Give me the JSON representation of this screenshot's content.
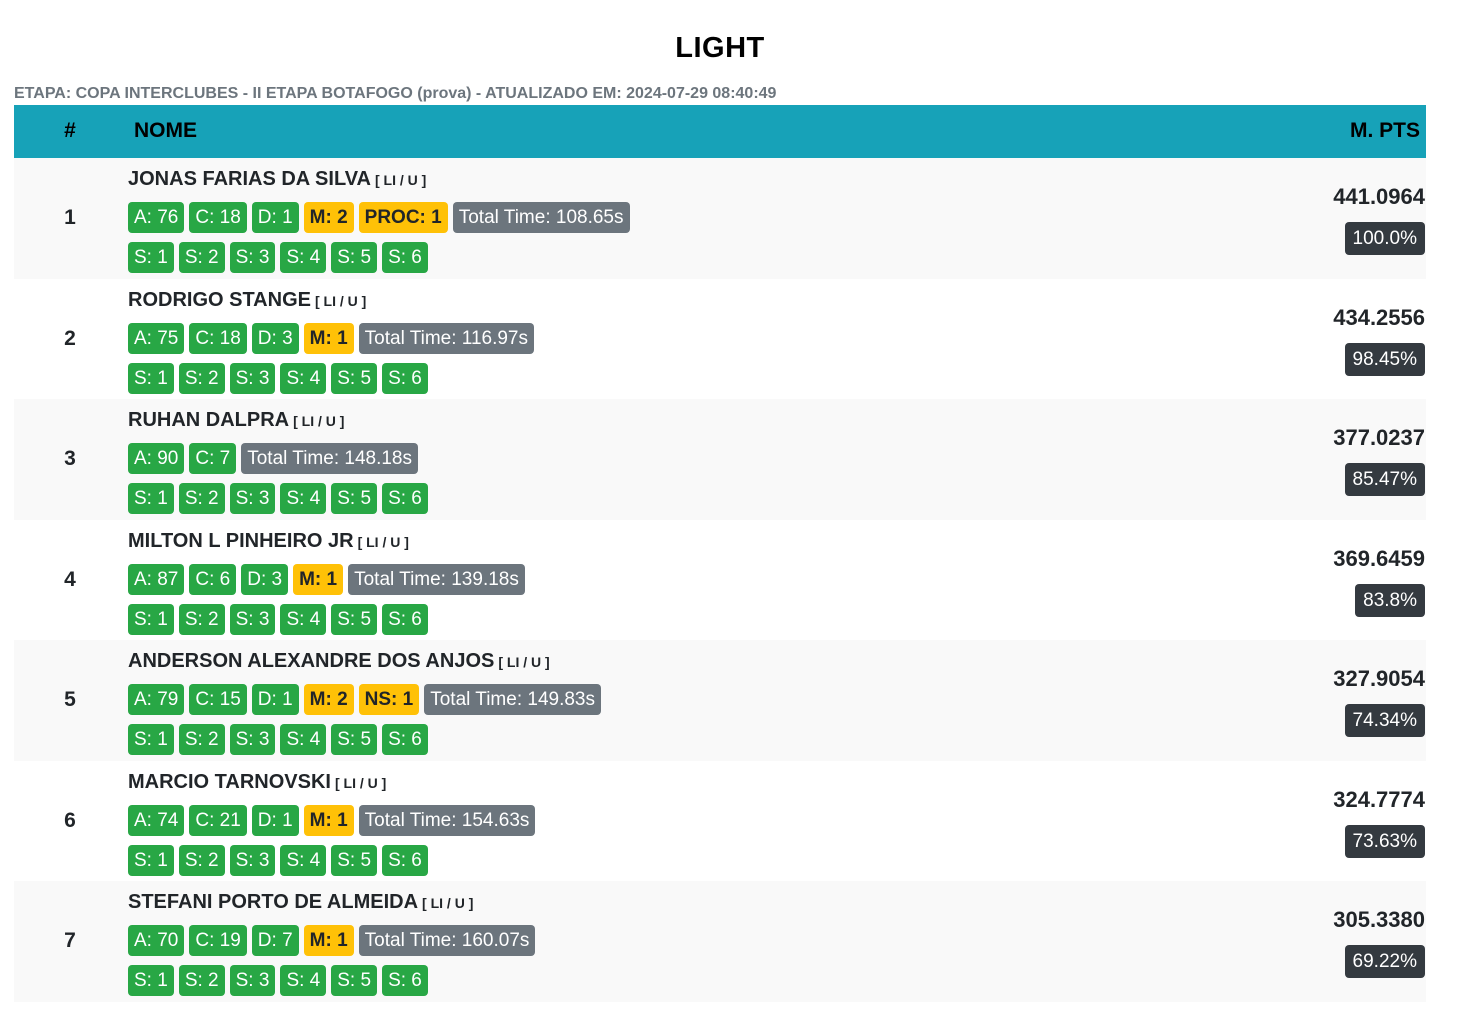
{
  "title": "LIGHT",
  "subtitle": "ETAPA: COPA INTERCLUBES - II ETAPA BOTAFOGO (prova) - ATUALIZADO EM: 2024-07-29 08:40:49",
  "colors": {
    "header_bg": "#17a2b8",
    "green": "#28a745",
    "yellow": "#ffc107",
    "gray": "#6c757d",
    "dark": "#343a40"
  },
  "header": {
    "rank": "#",
    "name": "NOME",
    "pts": "M. PTS"
  },
  "rows": [
    {
      "rank": "1",
      "name": "JONAS FARIAS DA SILVA",
      "category": "[ LI / U ]",
      "badges": [
        {
          "text": "A: 76",
          "color": "green"
        },
        {
          "text": "C: 18",
          "color": "green"
        },
        {
          "text": "D: 1",
          "color": "green"
        },
        {
          "text": "M: 2",
          "color": "yellow"
        },
        {
          "text": "PROC: 1",
          "color": "yellow"
        },
        {
          "text": "Total Time: 108.65s",
          "color": "gray"
        }
      ],
      "stages": [
        "S: 1",
        "S: 2",
        "S: 3",
        "S: 4",
        "S: 5",
        "S: 6"
      ],
      "points": "441.0964",
      "percent": "100.0%"
    },
    {
      "rank": "2",
      "name": "RODRIGO STANGE",
      "category": "[ LI / U ]",
      "badges": [
        {
          "text": "A: 75",
          "color": "green"
        },
        {
          "text": "C: 18",
          "color": "green"
        },
        {
          "text": "D: 3",
          "color": "green"
        },
        {
          "text": "M: 1",
          "color": "yellow"
        },
        {
          "text": "Total Time: 116.97s",
          "color": "gray"
        }
      ],
      "stages": [
        "S: 1",
        "S: 2",
        "S: 3",
        "S: 4",
        "S: 5",
        "S: 6"
      ],
      "points": "434.2556",
      "percent": "98.45%"
    },
    {
      "rank": "3",
      "name": "RUHAN DALPRA",
      "category": "[ LI / U ]",
      "badges": [
        {
          "text": "A: 90",
          "color": "green"
        },
        {
          "text": "C: 7",
          "color": "green"
        },
        {
          "text": "Total Time: 148.18s",
          "color": "gray"
        }
      ],
      "stages": [
        "S: 1",
        "S: 2",
        "S: 3",
        "S: 4",
        "S: 5",
        "S: 6"
      ],
      "points": "377.0237",
      "percent": "85.47%"
    },
    {
      "rank": "4",
      "name": "MILTON L PINHEIRO JR",
      "category": "[ LI / U ]",
      "badges": [
        {
          "text": "A: 87",
          "color": "green"
        },
        {
          "text": "C: 6",
          "color": "green"
        },
        {
          "text": "D: 3",
          "color": "green"
        },
        {
          "text": "M: 1",
          "color": "yellow"
        },
        {
          "text": "Total Time: 139.18s",
          "color": "gray"
        }
      ],
      "stages": [
        "S: 1",
        "S: 2",
        "S: 3",
        "S: 4",
        "S: 5",
        "S: 6"
      ],
      "points": "369.6459",
      "percent": "83.8%"
    },
    {
      "rank": "5",
      "name": "ANDERSON ALEXANDRE DOS ANJOS",
      "category": "[ LI / U ]",
      "badges": [
        {
          "text": "A: 79",
          "color": "green"
        },
        {
          "text": "C: 15",
          "color": "green"
        },
        {
          "text": "D: 1",
          "color": "green"
        },
        {
          "text": "M: 2",
          "color": "yellow"
        },
        {
          "text": "NS: 1",
          "color": "yellow"
        },
        {
          "text": "Total Time: 149.83s",
          "color": "gray"
        }
      ],
      "stages": [
        "S: 1",
        "S: 2",
        "S: 3",
        "S: 4",
        "S: 5",
        "S: 6"
      ],
      "points": "327.9054",
      "percent": "74.34%"
    },
    {
      "rank": "6",
      "name": "MARCIO TARNOVSKI",
      "category": "[ LI / U ]",
      "badges": [
        {
          "text": "A: 74",
          "color": "green"
        },
        {
          "text": "C: 21",
          "color": "green"
        },
        {
          "text": "D: 1",
          "color": "green"
        },
        {
          "text": "M: 1",
          "color": "yellow"
        },
        {
          "text": "Total Time: 154.63s",
          "color": "gray"
        }
      ],
      "stages": [
        "S: 1",
        "S: 2",
        "S: 3",
        "S: 4",
        "S: 5",
        "S: 6"
      ],
      "points": "324.7774",
      "percent": "73.63%"
    },
    {
      "rank": "7",
      "name": "STEFANI PORTO DE ALMEIDA",
      "category": "[ LI / U ]",
      "badges": [
        {
          "text": "A: 70",
          "color": "green"
        },
        {
          "text": "C: 19",
          "color": "green"
        },
        {
          "text": "D: 7",
          "color": "green"
        },
        {
          "text": "M: 1",
          "color": "yellow"
        },
        {
          "text": "Total Time: 160.07s",
          "color": "gray"
        }
      ],
      "stages": [
        "S: 1",
        "S: 2",
        "S: 3",
        "S: 4",
        "S: 5",
        "S: 6"
      ],
      "points": "305.3380",
      "percent": "69.22%"
    }
  ]
}
